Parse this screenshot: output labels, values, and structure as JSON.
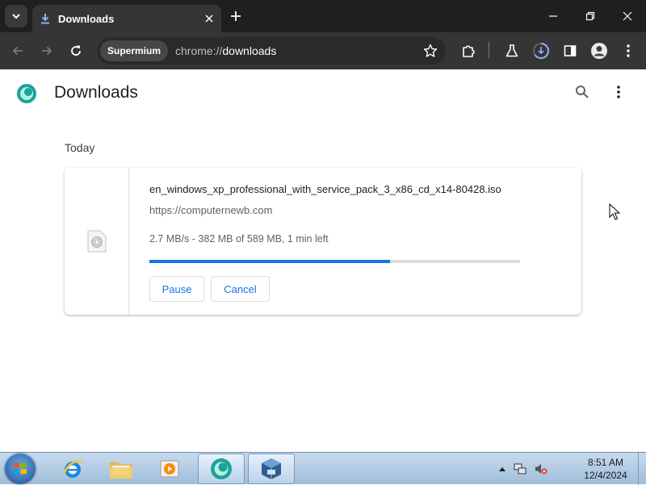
{
  "browser": {
    "tab_title": "Downloads",
    "site_chip": "Supermium",
    "url_scheme": "chrome://",
    "url_host": "downloads"
  },
  "page": {
    "title": "Downloads",
    "date_label": "Today"
  },
  "download": {
    "file_name": "en_windows_xp_professional_with_service_pack_3_x86_cd_x14-80428.iso",
    "source_url": "https://computernewb.com",
    "status": "2.7 MB/s - 382 MB of 589 MB, 1 min left",
    "progress_fraction": 0.6486,
    "pause_label": "Pause",
    "cancel_label": "Cancel"
  },
  "taskbar": {
    "apps": [
      "internet-explorer",
      "windows-explorer",
      "media-player",
      "supermium",
      "virtualbox"
    ],
    "clock_time": "8:51 AM",
    "clock_date": "12/4/2024"
  },
  "colors": {
    "accent": "#1a73e8",
    "chrome_dark": "#1f1f1f",
    "toolbar": "#353535"
  }
}
